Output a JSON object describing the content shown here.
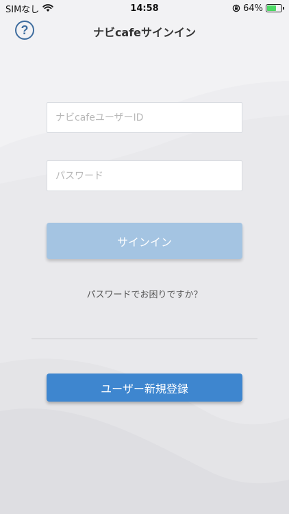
{
  "status": {
    "carrier": "SIMなし",
    "time": "14:58",
    "battery": "64%",
    "battery_level": 0.64,
    "icons": [
      "wifi-icon",
      "orientation-lock-icon",
      "battery-icon"
    ]
  },
  "nav": {
    "help_icon": "?",
    "title": "ナビcafeサインイン"
  },
  "form": {
    "user_id_placeholder": "ナビcafeユーザーID",
    "password_placeholder": "パスワード",
    "signin_label": "サインイン",
    "forgot_label": "パスワードでお困りですか？",
    "register_label": "ユーザー新規登録"
  },
  "colors": {
    "accent": "#3e86cf",
    "signin_disabled": "#a4c4e2",
    "help_icon": "#3d6c9e",
    "background": "#f2f2f4"
  }
}
